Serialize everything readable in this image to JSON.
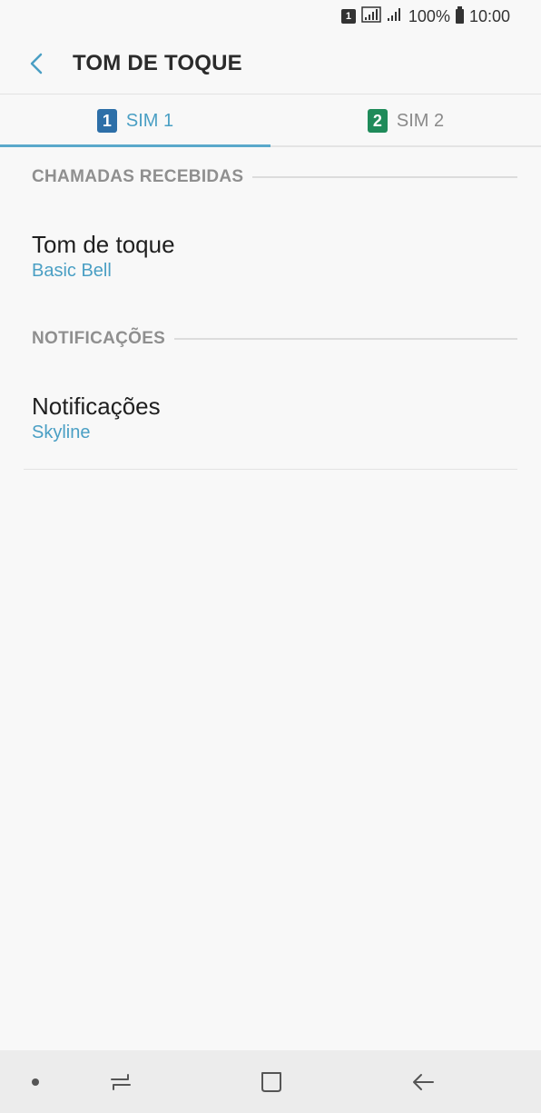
{
  "status_bar": {
    "sim_indicator": "1",
    "battery": "100%",
    "time": "10:00"
  },
  "header": {
    "title": "TOM DE TOQUE",
    "back_icon": "back-chevron-icon"
  },
  "tabs": [
    {
      "badge": "1",
      "label": "SIM 1",
      "active": true,
      "badge_color": "#2d6fa8"
    },
    {
      "badge": "2",
      "label": "SIM 2",
      "active": false,
      "badge_color": "#1f8b5a"
    }
  ],
  "sections": [
    {
      "header": "CHAMADAS RECEBIDAS",
      "item": {
        "title": "Tom de toque",
        "value": "Basic Bell"
      }
    },
    {
      "header": "NOTIFICAÇÕES",
      "item": {
        "title": "Notificações",
        "value": "Skyline"
      }
    }
  ],
  "colors": {
    "accent": "#4a9fc4",
    "background": "#f8f8f8"
  }
}
